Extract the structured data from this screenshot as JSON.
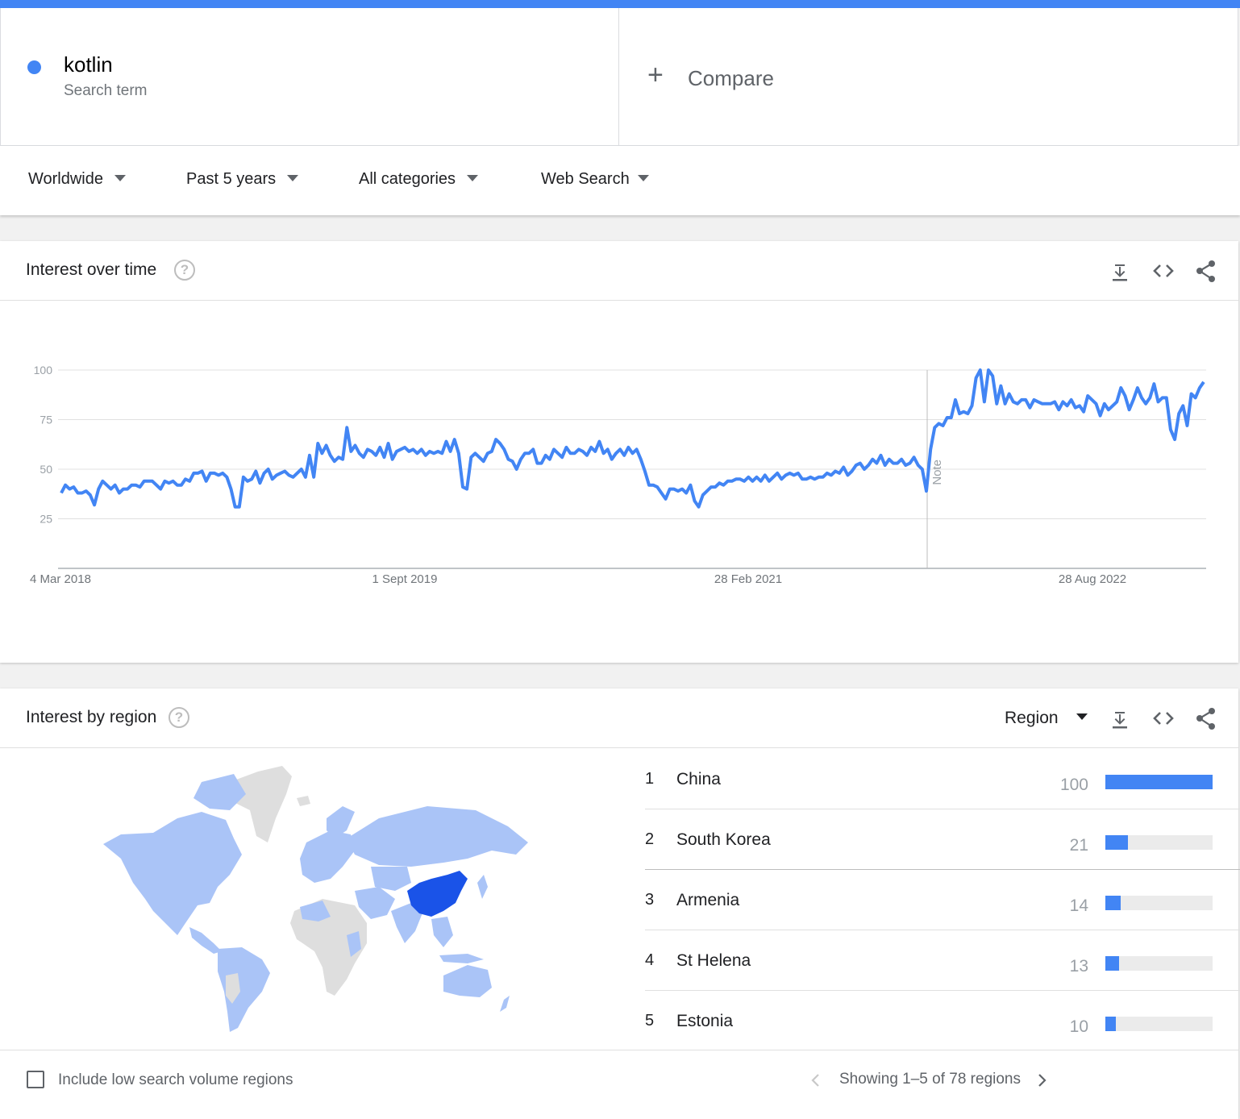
{
  "term": {
    "name": "kotlin",
    "type": "Search term",
    "color": "#4285f4"
  },
  "compare": {
    "label": "Compare"
  },
  "filters": {
    "location": "Worldwide",
    "time": "Past 5 years",
    "category": "All categories",
    "search_type": "Web Search"
  },
  "interest_over_time": {
    "title": "Interest over time",
    "help": "?",
    "note_label": "Note"
  },
  "chart_data": {
    "type": "line",
    "title": "Interest over time",
    "xlabel": "",
    "ylabel": "",
    "ylim": [
      0,
      100
    ],
    "yticks": [
      100,
      75,
      50,
      25
    ],
    "xticks": [
      "4 Mar 2018",
      "1 Sept 2019",
      "28 Feb 2021",
      "28 Aug 2022"
    ],
    "grid": true,
    "note_annotation": "Note",
    "series": [
      {
        "name": "kotlin",
        "color": "#4285f4",
        "values": [
          38,
          42,
          40,
          41,
          38,
          38,
          39,
          37,
          32,
          40,
          44,
          42,
          40,
          42,
          38,
          40,
          40,
          42,
          42,
          41,
          44,
          44,
          44,
          42,
          40,
          44,
          43,
          44,
          42,
          42,
          45,
          44,
          48,
          48,
          49,
          44,
          48,
          48,
          47,
          48,
          46,
          40,
          31,
          31,
          46,
          44,
          45,
          49,
          43,
          48,
          50,
          45,
          47,
          48,
          49,
          47,
          46,
          48,
          50,
          46,
          57,
          46,
          63,
          58,
          62,
          57,
          54,
          56,
          55,
          71,
          59,
          62,
          58,
          56,
          60,
          59,
          57,
          61,
          56,
          63,
          55,
          59,
          60,
          61,
          59,
          60,
          58,
          60,
          57,
          59,
          58,
          59,
          58,
          64,
          59,
          65,
          58,
          41,
          40,
          56,
          58,
          56,
          54,
          58,
          59,
          65,
          63,
          60,
          55,
          54,
          50,
          55,
          58,
          58,
          60,
          53,
          53,
          57,
          55,
          60,
          58,
          56,
          61,
          58,
          58,
          60,
          59,
          57,
          61,
          59,
          64,
          58,
          60,
          55,
          58,
          60,
          57,
          61,
          58,
          60,
          55,
          49,
          42,
          42,
          41,
          38,
          35,
          40,
          40,
          39,
          40,
          38,
          42,
          34,
          31,
          37,
          39,
          41,
          41,
          43,
          42,
          44,
          44,
          45,
          45,
          44,
          46,
          44,
          46,
          44,
          47,
          44,
          46,
          48,
          45,
          47,
          48,
          47,
          48,
          45,
          45,
          46,
          45,
          46,
          46,
          48,
          47,
          49,
          48,
          51,
          47,
          49,
          52,
          53,
          50,
          52,
          55,
          53,
          57,
          52,
          55,
          53,
          53,
          55,
          52,
          53,
          56,
          52,
          50,
          39,
          60,
          71,
          73,
          72,
          76,
          76,
          85,
          78,
          79,
          78,
          82,
          96,
          101,
          84,
          100,
          97,
          83,
          92,
          83,
          88,
          84,
          83,
          85,
          85,
          81,
          85,
          84,
          83,
          83,
          83,
          84,
          80,
          84,
          82,
          85,
          81,
          82,
          79,
          87,
          85,
          83,
          77,
          83,
          80,
          82,
          84,
          91,
          87,
          80,
          85,
          91,
          86,
          83,
          86,
          93,
          84,
          86,
          86,
          70,
          65,
          78,
          82,
          72,
          88,
          86,
          91,
          94
        ]
      }
    ]
  },
  "interest_by_region": {
    "title": "Interest by region",
    "help": "?",
    "resolution_label": "Region",
    "regions": [
      {
        "rank": "1",
        "name": "China",
        "value": "100",
        "fraction": 1.0
      },
      {
        "rank": "2",
        "name": "South Korea",
        "value": "21",
        "fraction": 0.21
      },
      {
        "rank": "3",
        "name": "Armenia",
        "value": "14",
        "fraction": 0.14
      },
      {
        "rank": "4",
        "name": "St Helena",
        "value": "13",
        "fraction": 0.13
      },
      {
        "rank": "5",
        "name": "Estonia",
        "value": "10",
        "fraction": 0.1
      }
    ],
    "include_low_volume_label": "Include low search volume regions",
    "pager_text": "Showing 1–5 of 78 regions",
    "map_colors": {
      "high": "#1a53e8",
      "low": "#aac4f7",
      "none": "#dedede"
    }
  }
}
